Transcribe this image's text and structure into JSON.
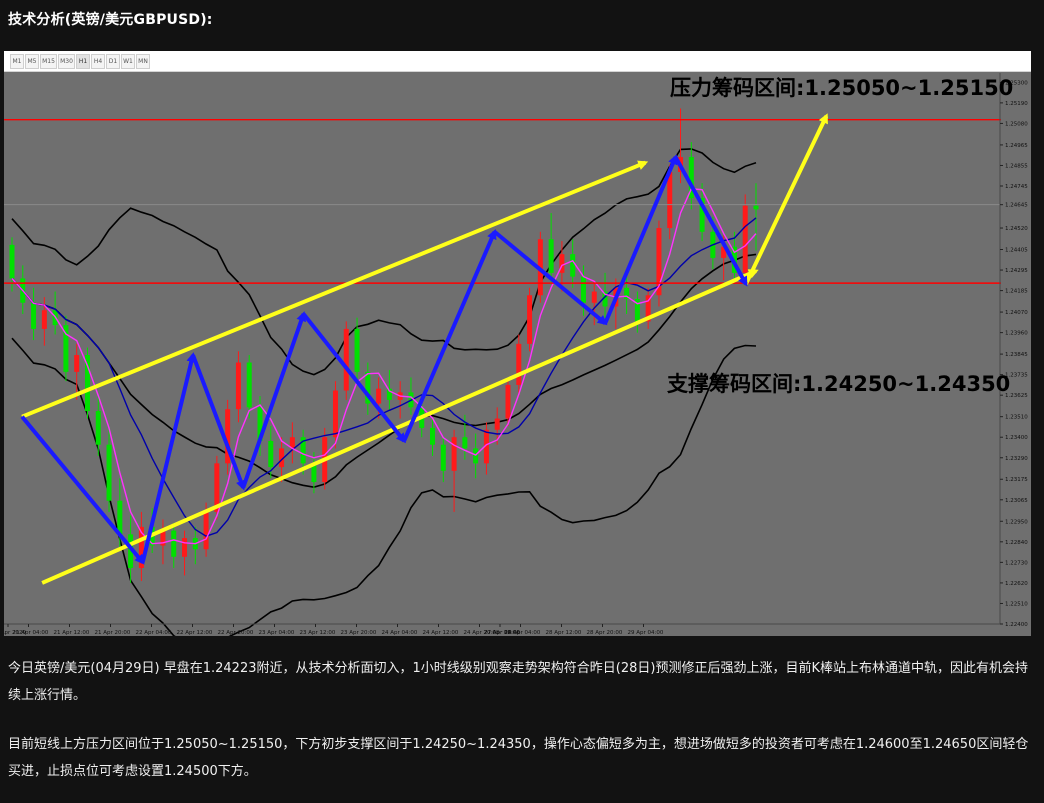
{
  "article": {
    "title": "技术分析(英镑/美元GBPUSD):",
    "paragraph1": "今日英镑/美元(04月29日) 早盘在1.24223附近，从技术分析面切入，1小时线级别观察走势架构符合昨日(28日)预测修正后强劲上涨，目前K棒站上布林通道中轨，因此有机会持续上涨行情。",
    "paragraph2": "目前短线上方压力区间位于1.25050~1.25150，下方初步支撑区间于1.24250~1.24350，操作心态偏短多为主，想进场做短多的投资者可考虑在1.24600至1.24650区间轻仓买进，止损点位可考虑设置1.24500下方。"
  },
  "toolbar": {
    "timeframes": [
      "M1",
      "M5",
      "M15",
      "M30",
      "H1",
      "H4",
      "D1",
      "W1",
      "MN"
    ],
    "active": "H1"
  },
  "chart_data": {
    "type": "candlestick",
    "annotations": {
      "resistance": "压力筹码区间:1.25050~1.25150",
      "support": "支撑筹码区间:1.24250~1.24350"
    },
    "y_ticks": [
      "1.25300",
      "1.25190",
      "1.25080",
      "1.24965",
      "1.24855",
      "1.24745",
      "1.24645",
      "1.24520",
      "1.24405",
      "1.24295",
      "1.24185",
      "1.24070",
      "1.23960",
      "1.23845",
      "1.23735",
      "1.23625",
      "1.23510",
      "1.23400",
      "1.23290",
      "1.23175",
      "1.23065",
      "1.22950",
      "1.22840",
      "1.22730",
      "1.22620",
      "1.22510",
      "1.22400"
    ],
    "x_ticks": [
      "21 Apr 2020",
      "21 Apr 04:00",
      "21 Apr 12:00",
      "21 Apr 20:00",
      "22 Apr 04:00",
      "22 Apr 12:00",
      "22 Apr 20:00",
      "23 Apr 04:00",
      "23 Apr 12:00",
      "23 Apr 20:00",
      "24 Apr 04:00",
      "24 Apr 12:00",
      "24 Apr 20:00",
      "27 Apr 04:00",
      "27 Apr 12:00",
      "27 Apr 20:00",
      "28 Apr 04:00",
      "28 Apr 12:00",
      "28 Apr 20:00",
      "29 Apr 04:00"
    ],
    "ylim": [
      1.224,
      1.2535
    ],
    "red_lines": [
      1.251,
      1.24225
    ],
    "gray_line": 1.24645,
    "current_price": "1.24645",
    "red_labels": [
      "1.25100",
      "1.24223"
    ],
    "colors": {
      "up": "#ff1a1a",
      "down": "#00e000",
      "channel": "#ffff1a",
      "waves": "#1a1aff",
      "bb": "#000000",
      "ma_fast": "#ff33ff",
      "ma_slow": "#0000aa",
      "background": "#6f6f6f",
      "level": "#ff0000"
    },
    "channel_upper": [
      [
        "21 Apr 04:00",
        1.2351
      ],
      [
        "28 Apr 08:00",
        1.2487
      ]
    ],
    "channel_lower": [
      [
        "21 Apr 08:00",
        1.2262
      ],
      [
        "29 Apr 06:00",
        1.2429
      ]
    ],
    "wave_path": [
      [
        "21 Apr 04:00",
        1.2351
      ],
      [
        "22 Apr 04:00",
        1.2273
      ],
      [
        "22 Apr 14:00",
        1.2384
      ],
      [
        "23 Apr 00:00",
        1.2313
      ],
      [
        "23 Apr 12:00",
        1.2406
      ],
      [
        "24 Apr 08:00",
        1.2338
      ],
      [
        "27 Apr 02:00",
        1.245
      ],
      [
        "28 Apr 00:00",
        1.2401
      ],
      [
        "28 Apr 14:00",
        1.249
      ],
      [
        "29 Apr 04:00",
        1.2422
      ]
    ],
    "forecast_arrow": [
      [
        "29 Apr 04:00",
        1.2422
      ],
      [
        "29 Apr 20:00",
        1.2512
      ]
    ],
    "candles": [
      {
        "o": 1.2443,
        "h": 1.2447,
        "l": 1.2418,
        "c": 1.2425
      },
      {
        "o": 1.2425,
        "h": 1.2432,
        "l": 1.2406,
        "c": 1.2412
      },
      {
        "o": 1.2412,
        "h": 1.242,
        "l": 1.2392,
        "c": 1.2398
      },
      {
        "o": 1.2398,
        "h": 1.2415,
        "l": 1.2389,
        "c": 1.2408
      },
      {
        "o": 1.2408,
        "h": 1.2418,
        "l": 1.2395,
        "c": 1.24
      },
      {
        "o": 1.24,
        "h": 1.2405,
        "l": 1.237,
        "c": 1.2375
      },
      {
        "o": 1.2375,
        "h": 1.239,
        "l": 1.236,
        "c": 1.2384
      },
      {
        "o": 1.2384,
        "h": 1.2388,
        "l": 1.235,
        "c": 1.2354
      },
      {
        "o": 1.2354,
        "h": 1.2362,
        "l": 1.233,
        "c": 1.2336
      },
      {
        "o": 1.2336,
        "h": 1.2345,
        "l": 1.23,
        "c": 1.2306
      },
      {
        "o": 1.2306,
        "h": 1.2318,
        "l": 1.228,
        "c": 1.2288
      },
      {
        "o": 1.2288,
        "h": 1.2298,
        "l": 1.2262,
        "c": 1.227
      },
      {
        "o": 1.227,
        "h": 1.23,
        "l": 1.2263,
        "c": 1.2292
      },
      {
        "o": 1.2292,
        "h": 1.2302,
        "l": 1.2278,
        "c": 1.2282
      },
      {
        "o": 1.2282,
        "h": 1.2296,
        "l": 1.2272,
        "c": 1.229
      },
      {
        "o": 1.229,
        "h": 1.2294,
        "l": 1.227,
        "c": 1.2276
      },
      {
        "o": 1.2276,
        "h": 1.229,
        "l": 1.2266,
        "c": 1.2286
      },
      {
        "o": 1.2286,
        "h": 1.2292,
        "l": 1.2272,
        "c": 1.228
      },
      {
        "o": 1.228,
        "h": 1.2305,
        "l": 1.2276,
        "c": 1.23
      },
      {
        "o": 1.23,
        "h": 1.233,
        "l": 1.2296,
        "c": 1.2326
      },
      {
        "o": 1.2326,
        "h": 1.236,
        "l": 1.232,
        "c": 1.2355
      },
      {
        "o": 1.2355,
        "h": 1.2386,
        "l": 1.2348,
        "c": 1.238
      },
      {
        "o": 1.238,
        "h": 1.2384,
        "l": 1.235,
        "c": 1.2356
      },
      {
        "o": 1.2356,
        "h": 1.2362,
        "l": 1.233,
        "c": 1.2338
      },
      {
        "o": 1.2338,
        "h": 1.2346,
        "l": 1.2318,
        "c": 1.2324
      },
      {
        "o": 1.2324,
        "h": 1.234,
        "l": 1.2316,
        "c": 1.2334
      },
      {
        "o": 1.2334,
        "h": 1.2348,
        "l": 1.2326,
        "c": 1.234
      },
      {
        "o": 1.234,
        "h": 1.2344,
        "l": 1.232,
        "c": 1.2326
      },
      {
        "o": 1.2326,
        "h": 1.2332,
        "l": 1.231,
        "c": 1.2316
      },
      {
        "o": 1.2316,
        "h": 1.2345,
        "l": 1.2312,
        "c": 1.234
      },
      {
        "o": 1.234,
        "h": 1.237,
        "l": 1.2334,
        "c": 1.2365
      },
      {
        "o": 1.2365,
        "h": 1.2402,
        "l": 1.236,
        "c": 1.2398
      },
      {
        "o": 1.2398,
        "h": 1.2404,
        "l": 1.237,
        "c": 1.2375
      },
      {
        "o": 1.2375,
        "h": 1.238,
        "l": 1.2352,
        "c": 1.2358
      },
      {
        "o": 1.2358,
        "h": 1.2372,
        "l": 1.235,
        "c": 1.2366
      },
      {
        "o": 1.2366,
        "h": 1.2376,
        "l": 1.2354,
        "c": 1.236
      },
      {
        "o": 1.236,
        "h": 1.237,
        "l": 1.235,
        "c": 1.2364
      },
      {
        "o": 1.2364,
        "h": 1.2372,
        "l": 1.2352,
        "c": 1.2356
      },
      {
        "o": 1.2356,
        "h": 1.2362,
        "l": 1.234,
        "c": 1.2345
      },
      {
        "o": 1.2345,
        "h": 1.235,
        "l": 1.233,
        "c": 1.2336
      },
      {
        "o": 1.2336,
        "h": 1.234,
        "l": 1.2316,
        "c": 1.2322
      },
      {
        "o": 1.2322,
        "h": 1.2344,
        "l": 1.23,
        "c": 1.234
      },
      {
        "o": 1.234,
        "h": 1.2352,
        "l": 1.2328,
        "c": 1.2334
      },
      {
        "o": 1.2334,
        "h": 1.2342,
        "l": 1.2318,
        "c": 1.2326
      },
      {
        "o": 1.2326,
        "h": 1.2348,
        "l": 1.232,
        "c": 1.2344
      },
      {
        "o": 1.2344,
        "h": 1.2356,
        "l": 1.2336,
        "c": 1.235
      },
      {
        "o": 1.235,
        "h": 1.2372,
        "l": 1.2346,
        "c": 1.2368
      },
      {
        "o": 1.2368,
        "h": 1.2395,
        "l": 1.2362,
        "c": 1.239
      },
      {
        "o": 1.239,
        "h": 1.242,
        "l": 1.2386,
        "c": 1.2416
      },
      {
        "o": 1.2416,
        "h": 1.245,
        "l": 1.2412,
        "c": 1.2446
      },
      {
        "o": 1.2446,
        "h": 1.246,
        "l": 1.2422,
        "c": 1.2428
      },
      {
        "o": 1.2428,
        "h": 1.2445,
        "l": 1.2418,
        "c": 1.2438
      },
      {
        "o": 1.2438,
        "h": 1.2446,
        "l": 1.242,
        "c": 1.2426
      },
      {
        "o": 1.2426,
        "h": 1.2432,
        "l": 1.2405,
        "c": 1.2412
      },
      {
        "o": 1.2412,
        "h": 1.2424,
        "l": 1.24,
        "c": 1.2418
      },
      {
        "o": 1.2418,
        "h": 1.2428,
        "l": 1.2404,
        "c": 1.241
      },
      {
        "o": 1.241,
        "h": 1.2425,
        "l": 1.2398,
        "c": 1.242
      },
      {
        "o": 1.242,
        "h": 1.243,
        "l": 1.2406,
        "c": 1.2414
      },
      {
        "o": 1.2414,
        "h": 1.2418,
        "l": 1.2396,
        "c": 1.2402
      },
      {
        "o": 1.2402,
        "h": 1.242,
        "l": 1.2398,
        "c": 1.2416
      },
      {
        "o": 1.2416,
        "h": 1.2456,
        "l": 1.241,
        "c": 1.2452
      },
      {
        "o": 1.2452,
        "h": 1.2486,
        "l": 1.2446,
        "c": 1.2482
      },
      {
        "o": 1.2482,
        "h": 1.2516,
        "l": 1.2476,
        "c": 1.249
      },
      {
        "o": 1.249,
        "h": 1.2498,
        "l": 1.2462,
        "c": 1.2468
      },
      {
        "o": 1.2468,
        "h": 1.2476,
        "l": 1.2445,
        "c": 1.245
      },
      {
        "o": 1.245,
        "h": 1.2458,
        "l": 1.243,
        "c": 1.2436
      },
      {
        "o": 1.2436,
        "h": 1.2448,
        "l": 1.2424,
        "c": 1.2442
      },
      {
        "o": 1.2442,
        "h": 1.245,
        "l": 1.2422,
        "c": 1.2428
      },
      {
        "o": 1.2428,
        "h": 1.247,
        "l": 1.2424,
        "c": 1.2464
      },
      {
        "o": 1.2464,
        "h": 1.2476,
        "l": 1.244,
        "c": 1.2462
      }
    ]
  }
}
